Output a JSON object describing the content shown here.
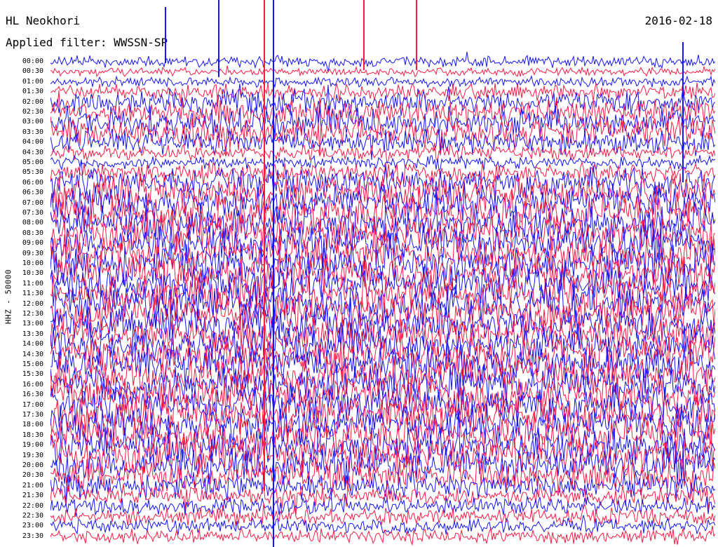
{
  "header": {
    "station": "HL Neokhori",
    "filter": "Applied filter: WWSSN-SP",
    "date": "2016-02-18"
  },
  "axis": {
    "ylabel": "HHZ - 50000"
  },
  "colors": {
    "trace_a": "#1414ff",
    "trace_b": "#ff1a44",
    "background": "#ffffff"
  },
  "rows": [
    "00:00",
    "00:30",
    "01:00",
    "01:30",
    "02:00",
    "02:30",
    "03:00",
    "03:30",
    "04:00",
    "04:30",
    "05:00",
    "05:30",
    "06:00",
    "06:30",
    "07:00",
    "07:30",
    "08:00",
    "08:30",
    "09:00",
    "09:30",
    "10:00",
    "10:30",
    "11:00",
    "11:30",
    "12:00",
    "12:30",
    "13:00",
    "13:30",
    "14:00",
    "14:30",
    "15:00",
    "15:30",
    "16:00",
    "16:30",
    "17:00",
    "17:30",
    "18:00",
    "18:30",
    "19:00",
    "19:30",
    "20:00",
    "20:30",
    "21:00",
    "21:30",
    "22:00",
    "22:30",
    "23:00",
    "23:30"
  ],
  "noise_level": [
    0.2,
    0.1,
    0.15,
    0.35,
    0.6,
    0.7,
    0.75,
    0.8,
    0.55,
    0.3,
    0.25,
    0.45,
    0.8,
    0.9,
    0.95,
    1.0,
    1.0,
    1.0,
    1.0,
    1.0,
    1.0,
    1.0,
    1.0,
    1.0,
    1.0,
    1.0,
    1.0,
    1.0,
    1.0,
    1.0,
    1.0,
    1.0,
    1.0,
    1.0,
    1.0,
    1.0,
    1.0,
    1.0,
    1.0,
    1.0,
    0.95,
    0.85,
    0.6,
    0.45,
    0.4,
    0.35,
    0.3,
    0.3
  ]
}
